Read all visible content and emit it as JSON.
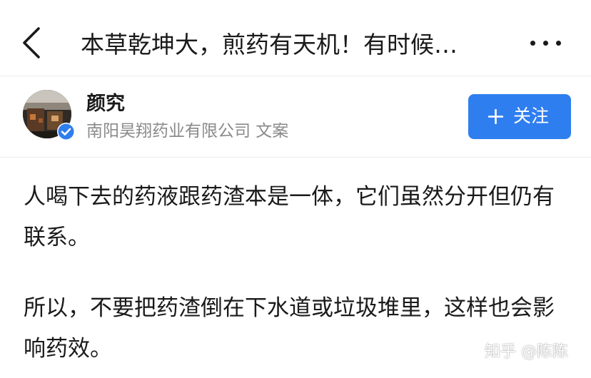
{
  "header": {
    "back_icon": "chevron-left-icon",
    "title": "本草乾坤大，煎药有天机！有时候…",
    "more_icon": "more-horizontal-icon"
  },
  "author": {
    "name": "颜究",
    "description": "南阳昊翔药业有限公司 文案",
    "verified_icon": "verified-check-icon",
    "verified_color": "#2f7ef0"
  },
  "follow_button": {
    "icon": "plus-icon",
    "label": "关注",
    "color": "#2f7ef0"
  },
  "content": {
    "paragraphs": [
      "人喝下去的药液跟药渣本是一体，它们虽然分开但仍有联系。",
      "所以，不要把药渣倒在下水道或垃圾堆里，这样也会影响药效。"
    ]
  },
  "watermark": {
    "text": "知乎 @陈陈"
  }
}
